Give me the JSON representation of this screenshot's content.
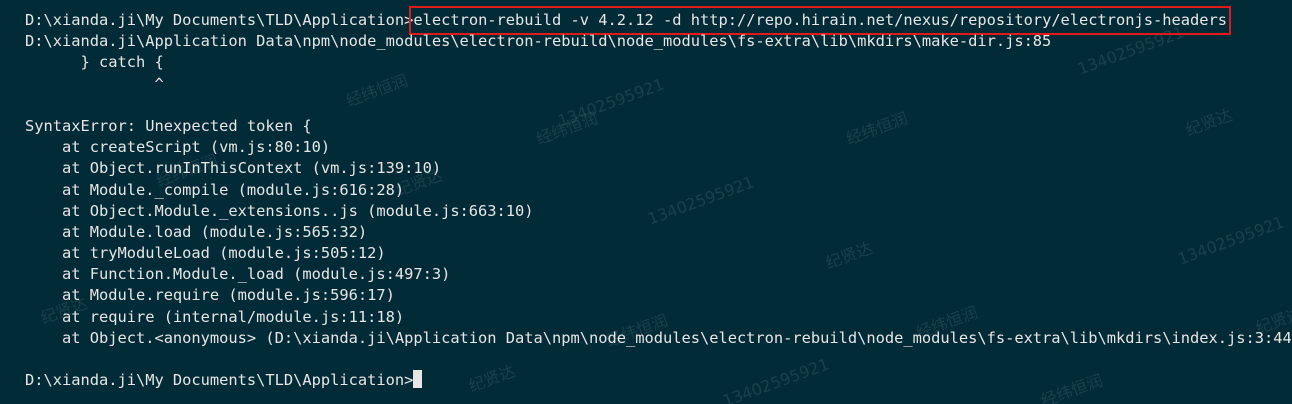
{
  "terminal": {
    "prompt_path": "D:\\xianda.ji\\My Documents\\TLD\\Application>",
    "command": "electron-rebuild -v 4.2.12 -d http://repo.hirain.net/nexus/repository/electronjs-headers",
    "error_file": "D:\\xianda.ji\\Application Data\\npm\\node_modules\\electron-rebuild\\node_modules\\fs-extra\\lib\\mkdirs\\make-dir.js:85",
    "code_line": "      } catch {",
    "caret_line": "              ^",
    "error_message": "SyntaxError: Unexpected token {",
    "stack": [
      "    at createScript (vm.js:80:10)",
      "    at Object.runInThisContext (vm.js:139:10)",
      "    at Module._compile (module.js:616:28)",
      "    at Object.Module._extensions..js (module.js:663:10)",
      "    at Module.load (module.js:565:32)",
      "    at tryModuleLoad (module.js:505:12)",
      "    at Function.Module._load (module.js:497:3)",
      "    at Module.require (module.js:596:17)",
      "    at require (internal/module.js:11:18)",
      "    at Object.<anonymous> (D:\\xianda.ji\\Application Data\\npm\\node_modules\\electron-rebuild\\node_modules\\fs-extra\\lib\\mkdirs\\index.js:3:44)"
    ],
    "final_prompt": "D:\\xianda.ji\\My Documents\\TLD\\Application>"
  },
  "colors": {
    "background": "#012b36",
    "text": "#e6e6e6",
    "highlight_box": "#e01919"
  },
  "watermarks": {
    "name_a": "经纬恒润",
    "name_b": "纪贤达",
    "phone": "13402595921"
  }
}
